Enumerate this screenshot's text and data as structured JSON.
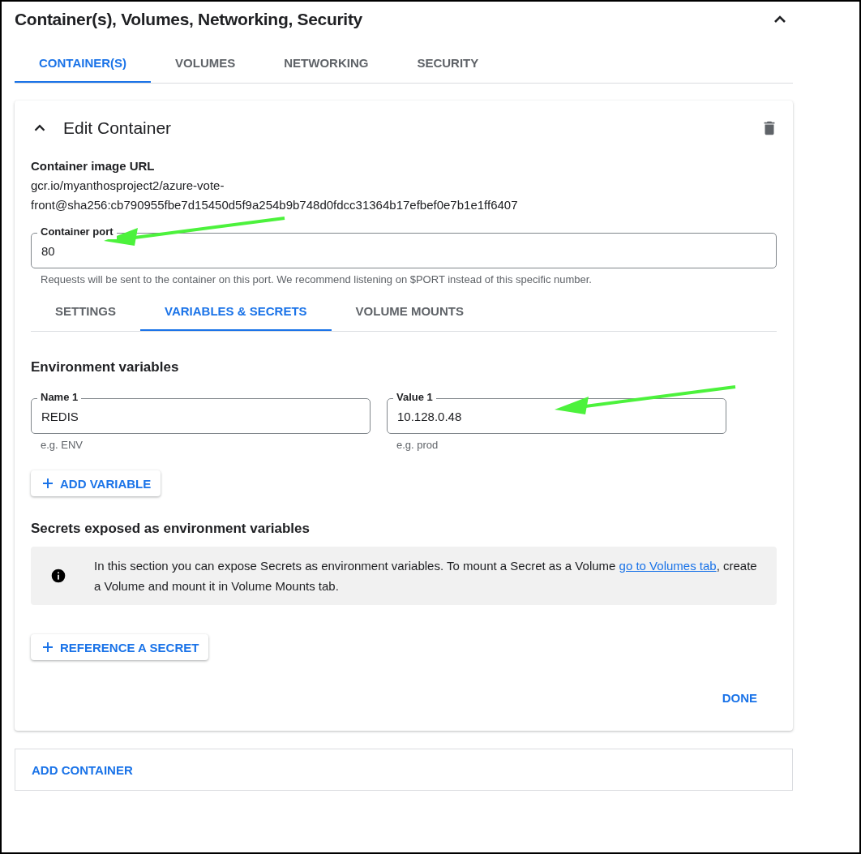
{
  "section": {
    "title": "Container(s), Volumes, Networking, Security",
    "expanded": true
  },
  "tabs": [
    {
      "label": "CONTAINER(S)",
      "selected": true
    },
    {
      "label": "VOLUMES",
      "selected": false
    },
    {
      "label": "NETWORKING",
      "selected": false
    },
    {
      "label": "SECURITY",
      "selected": false
    }
  ],
  "editor": {
    "title": "Edit Container",
    "expanded": true,
    "image_url_label": "Container image URL",
    "image_url": "gcr.io/myanthosproject2/azure-vote-front@sha256:cb790955fbe7d15450d5f9a254b9b748d0fdcc31364b17efbef0e7b1e1ff6407",
    "port": {
      "label": "Container port",
      "value": "80",
      "helper": "Requests will be sent to the container on this port. We recommend listening on $PORT instead of this specific number."
    },
    "tabs": [
      {
        "label": "SETTINGS",
        "selected": false
      },
      {
        "label": "VARIABLES & SECRETS",
        "selected": true
      },
      {
        "label": "VOLUME MOUNTS",
        "selected": false
      }
    ],
    "env_heading": "Environment variables",
    "variables": [
      {
        "name_label": "Name 1",
        "name": "REDIS",
        "name_helper": "e.g. ENV",
        "value_label": "Value 1",
        "value": "10.128.0.48",
        "value_helper": "e.g. prod"
      }
    ],
    "add_variable": "ADD VARIABLE",
    "secrets_heading": "Secrets exposed as environment variables",
    "info": {
      "before": "In this section you can expose Secrets as environment variables. To mount a Secret as a Volume ",
      "link": "go to Volumes tab",
      "after": ", create a Volume and mount it in Volume Mounts tab."
    },
    "reference_secret": "REFERENCE A SECRET",
    "done": "DONE"
  },
  "add_container": "ADD CONTAINER"
}
